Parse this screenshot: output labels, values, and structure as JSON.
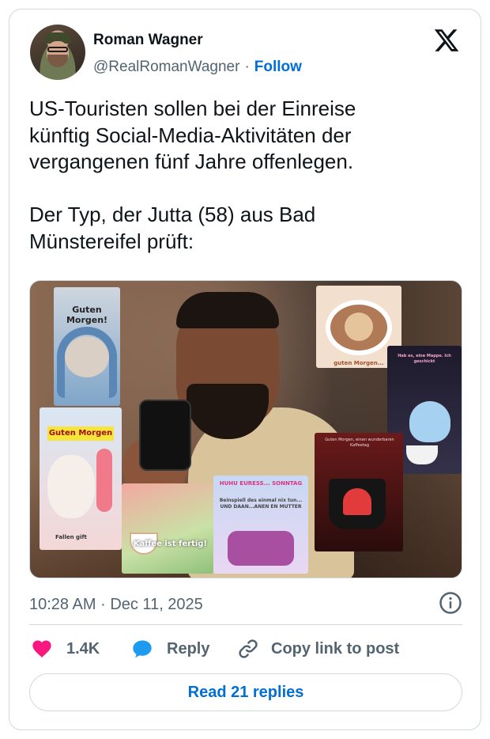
{
  "author": {
    "name": "Roman Wagner",
    "handle": "@RealRomanWagner",
    "separator": "·",
    "follow_label": "Follow"
  },
  "tweet": {
    "text": "US-Touristen sollen bei der Einreise\nkünftig Social-Media-Aktivitäten der\nvergangenen fünf Jahre offenlegen.\n\nDer Typ, der Jutta (58) aus Bad\nMünstereifel prüft:"
  },
  "media": {
    "tiles": {
      "hamster": "Guten Morgen!",
      "kitten_banner": "Guten Morgen",
      "kitten_footer": "Fallen gift",
      "coffee_ready": "Kaffee ist fertig!",
      "sunday_top": "HUHU EURESS... SONNTAG",
      "sunday_bottom": "Beinspiell des einmal nix tun... UND DAAN...ANEN EN MUTTER",
      "bear_cup": "guten Morgen...",
      "teapot_text": "Hab es, eine Mappe. Ich geschickt",
      "heart_mug_text": "Guten Morgen, einen wunderbaren Kaffeetag"
    }
  },
  "meta": {
    "time": "10:28 AM",
    "separator": "·",
    "date": "Dec 11, 2025"
  },
  "actions": {
    "likes": "1.4K",
    "reply": "Reply",
    "copy_link": "Copy link to post"
  },
  "read_replies": "Read 21 replies",
  "colors": {
    "accent": "#006fd6",
    "like": "#f91880",
    "reply_icon": "#1d9bf0",
    "muted": "#536471",
    "border": "#cfd9de"
  },
  "icons": [
    "x-logo-icon",
    "info-icon",
    "heart-icon",
    "reply-bubble-icon",
    "link-icon"
  ]
}
